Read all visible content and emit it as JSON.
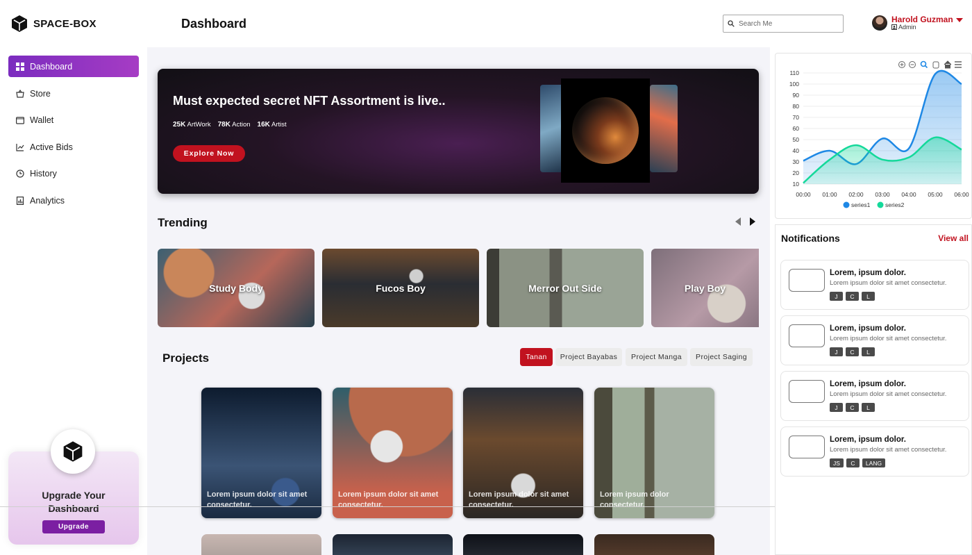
{
  "app": {
    "name": "SPACE-BOX",
    "page_title": "Dashboard"
  },
  "search": {
    "placeholder": "Search Me"
  },
  "user": {
    "name": "Harold Guzman",
    "role": "Admin"
  },
  "sidebar": {
    "items": [
      {
        "label": "Dashboard",
        "icon": "grid-icon",
        "active": true
      },
      {
        "label": "Store",
        "icon": "basket-icon"
      },
      {
        "label": "Wallet",
        "icon": "wallet-icon"
      },
      {
        "label": "Active Bids",
        "icon": "trend-chart-icon"
      },
      {
        "label": "History",
        "icon": "clock-icon"
      },
      {
        "label": "Analytics",
        "icon": "report-icon"
      }
    ],
    "upgrade": {
      "title_line1": "Upgrade Your",
      "title_line2": "Dashboard",
      "button": "Upgrade"
    }
  },
  "banner": {
    "title": "Must expected secret NFT Assortment is live..",
    "stats": [
      {
        "value": "25K",
        "label": "ArtWork"
      },
      {
        "value": "78K",
        "label": "Action"
      },
      {
        "value": "16K",
        "label": "Artist"
      }
    ],
    "button": "Explore Now"
  },
  "trending": {
    "title": "Trending",
    "items": [
      "Study Body",
      "Fucos Boy",
      "Merror Out Side",
      "Play Boy"
    ]
  },
  "projects": {
    "title": "Projects",
    "filters": [
      "Tanan",
      "Project Bayabas",
      "Project Manga",
      "Project Saging"
    ],
    "active_filter": "Tanan",
    "cards": [
      {
        "caption": "Lorem ipsum dolor sit amet consectetur."
      },
      {
        "caption": "Lorem ipsum dolor sit amet consectetur."
      },
      {
        "caption": "Lorem ipsum dolor sit amet consectetur."
      },
      {
        "caption": "Lorem ipsum dolor consectetur."
      }
    ]
  },
  "notifications": {
    "title": "Notifications",
    "view_all": "View all",
    "items": [
      {
        "heading": "Lorem, ipsum dolor.",
        "body": "Lorem ipsum dolor sit amet consectetur.",
        "tags": [
          "J",
          "C",
          "L"
        ]
      },
      {
        "heading": "Lorem, ipsum dolor.",
        "body": "Lorem ipsum dolor sit amet consectetur.",
        "tags": [
          "J",
          "C",
          "L"
        ]
      },
      {
        "heading": "Lorem, ipsum dolor.",
        "body": "Lorem ipsum dolor sit amet consectetur.",
        "tags": [
          "J",
          "C",
          "L"
        ]
      },
      {
        "heading": "Lorem, ipsum dolor.",
        "body": "Lorem ipsum dolor sit amet consectetur.",
        "tags": [
          "JS",
          "C",
          "LANG"
        ]
      }
    ]
  },
  "colors": {
    "accent": "#c1121f",
    "purple": "#7b2cbf",
    "series1": "#1e88e5",
    "series2": "#14d99a"
  },
  "chart_data": {
    "type": "area",
    "x": [
      "00:00",
      "01:00",
      "02:00",
      "03:00",
      "04:00",
      "05:00",
      "06:00"
    ],
    "yticks": [
      10,
      20,
      30,
      40,
      50,
      60,
      70,
      80,
      90,
      100,
      110
    ],
    "ylim": [
      10,
      110
    ],
    "series": [
      {
        "name": "series1",
        "values": [
          31,
          40,
          28,
          51,
          42,
          109,
          100
        ]
      },
      {
        "name": "series2",
        "values": [
          11,
          32,
          45,
          32,
          34,
          52,
          41
        ]
      }
    ],
    "legend": "bottom",
    "grid": true
  }
}
